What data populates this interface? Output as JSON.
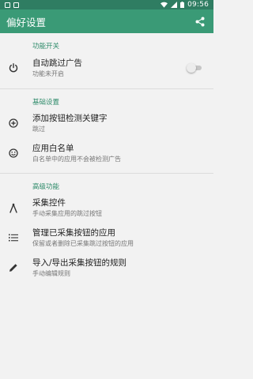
{
  "statusbar": {
    "time": "09:56"
  },
  "app": {
    "title": "偏好设置",
    "accent": "#3a9a76",
    "statusbar_color": "#2f7d62"
  },
  "sections": [
    {
      "header": "功能开关",
      "items": [
        {
          "title": "自动跳过广告",
          "subtitle": "功能未开启",
          "icon": "power-icon",
          "toggle_on": false
        }
      ]
    },
    {
      "header": "基础设置",
      "items": [
        {
          "title": "添加按钮检测关键字",
          "subtitle": "跳过",
          "icon": "add-circle-icon"
        },
        {
          "title": "应用白名单",
          "subtitle": "白名单中的应用不会被检测广告",
          "icon": "smiley-icon"
        }
      ]
    },
    {
      "header": "高级功能",
      "items": [
        {
          "title": "采集控件",
          "subtitle": "手动采集应用的跳过按钮",
          "icon": "compass-icon"
        },
        {
          "title": "管理已采集按钮的应用",
          "subtitle": "保留或者删除已采集跳过按钮的应用",
          "icon": "list-icon"
        },
        {
          "title": "导入/导出采集按钮的规则",
          "subtitle": "手动编辑规则",
          "icon": "edit-icon"
        }
      ]
    }
  ]
}
